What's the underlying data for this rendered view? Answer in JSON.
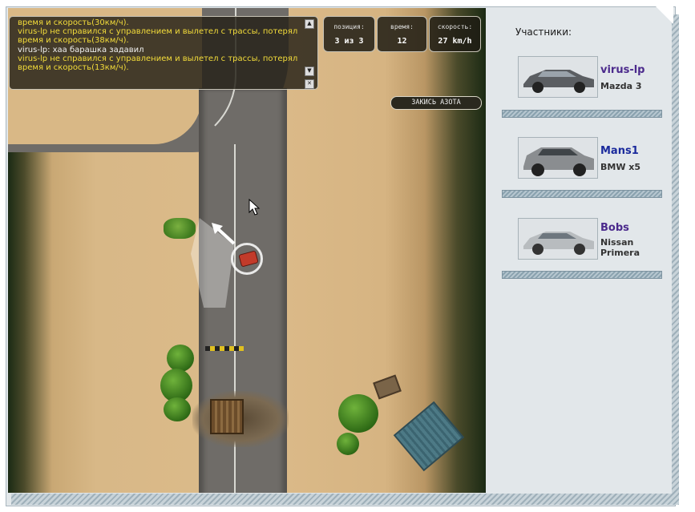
{
  "chat": {
    "lines": [
      {
        "text": "время и скорость(30км/ч).",
        "color": "yellow"
      },
      {
        "text": "virus-lp не справился с управлением и вылетел с трассы, потерял",
        "color": "yellow"
      },
      {
        "text": "время и скорость(38км/ч).",
        "color": "yellow"
      },
      {
        "text": "virus-lp: хаа барашка задавил",
        "color": "white"
      },
      {
        "text": "virus-lp не справился с управлением и вылетел с трассы, потерял",
        "color": "yellow"
      },
      {
        "text": "время и скорость(13км/ч).",
        "color": "yellow"
      }
    ]
  },
  "stats": {
    "position_label": "позиция:",
    "position_value": "3 из 3",
    "time_label": "время:",
    "time_value": "12",
    "speed_label": "скорость:",
    "speed_value": "27 km/h"
  },
  "nitro_button": "ЗАКИСЬ АЗОТА",
  "participants_title": "Участники:",
  "participants": [
    {
      "name": "virus-lp",
      "car": "Mazda 3",
      "name_color": "#4b2a8c"
    },
    {
      "name": "Mans1",
      "car": "BMW x5",
      "name_color": "#1a2a9c"
    },
    {
      "name": "Bobs",
      "car": "Nissan Primera",
      "name_color": "#4b2a8c"
    }
  ],
  "icons": [
    "scroll-up-icon",
    "scroll-down-icon",
    "close-icon",
    "mouse-cursor-icon",
    "direction-arrow-icon"
  ]
}
